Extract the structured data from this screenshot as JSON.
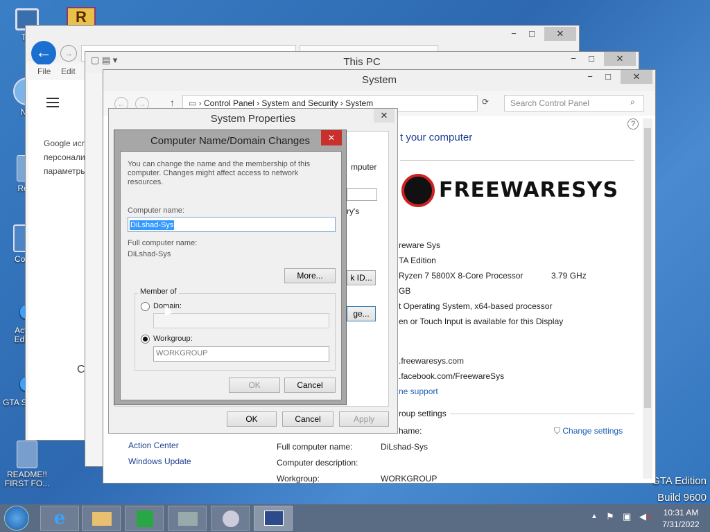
{
  "desktop": {
    "icons": [
      {
        "label": "Thi",
        "icon": "monitor-icon"
      },
      {
        "label": "Net",
        "icon": "network-icon"
      },
      {
        "label": "Recy",
        "icon": "recycle-bin-icon"
      },
      {
        "label": "Contro",
        "icon": "control-panel-icon"
      },
      {
        "label": "Activat Edition",
        "icon": "ie-icon"
      },
      {
        "label": "GTA S - Foru",
        "icon": "ie-icon"
      },
      {
        "label": "README!! FIRST FO...",
        "icon": "document-icon"
      }
    ],
    "watermark_line1": "GTA Edition",
    "watermark_line2": "Build 9600"
  },
  "browser": {
    "menu_file": "File",
    "menu_edit": "Edit",
    "text1": "Google иcr",
    "text2": "персонали",
    "text3": "параметры",
    "side_letter": "C"
  },
  "thispc": {
    "title": "This PC"
  },
  "system": {
    "title": "System",
    "breadcrumb": [
      "Control Panel",
      "System and Security",
      "System"
    ],
    "search_placeholder": "Search Control Panel",
    "heading": "t your computer",
    "logo_text": "FREEWARESYS",
    "info_lines": [
      "reware Sys",
      "TA Edition",
      "Ryzen 7 5800X 8-Core Processor",
      "GB",
      "t Operating System, x64-based processor",
      "en or Touch Input is available for this Display"
    ],
    "cpu_speed": "3.79 GHz",
    "link1": ".freewaresys.com",
    "link2": ".facebook.com/FreewareSys",
    "support_link": "ne support",
    "group_settings": "roup settings",
    "side_group_label": "hame:",
    "change_settings": "Change settings",
    "see_also_1": "Action Center",
    "see_also_2": "Windows Update",
    "full_name_label": "Full computer name:",
    "full_name_value": "DiLshad-Sys",
    "description_label": "Computer description:",
    "workgroup_label": "Workgroup:",
    "workgroup_value": "WORKGROUP"
  },
  "sysprops": {
    "title": "System Properties",
    "frag1": "mputer",
    "frag2": "ry's",
    "btn_network_id": "k ID...",
    "btn_change": "ge...",
    "ok": "OK",
    "cancel": "Cancel",
    "apply": "Apply"
  },
  "dialog": {
    "title": "Computer Name/Domain Changes",
    "description": "You can change the name and the membership of this computer. Changes might affect access to network resources.",
    "computer_name_label": "Computer name:",
    "computer_name_value": "DiLshad-Sys",
    "full_name_label": "Full computer name:",
    "full_name_value": "DiLshad-Sys",
    "more_button": "More...",
    "member_of_label": "Member of",
    "domain_label": "Domain:",
    "domain_value": "",
    "workgroup_label": "Workgroup:",
    "workgroup_value": "WORKGROUP",
    "ok": "OK",
    "cancel": "Cancel"
  },
  "taskbar": {
    "time": "10:31 AM",
    "date": "7/31/2022"
  }
}
